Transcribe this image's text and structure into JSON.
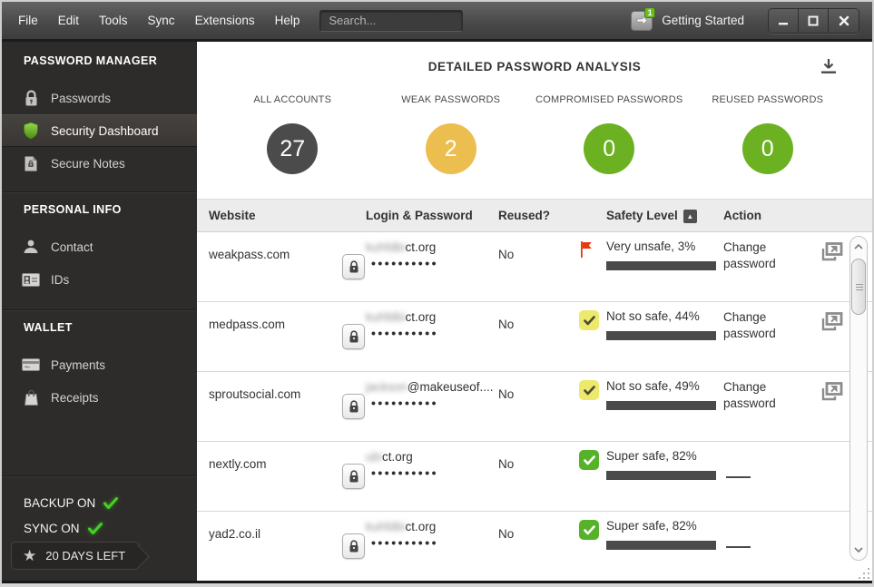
{
  "titlebar": {
    "menu": [
      "File",
      "Edit",
      "Tools",
      "Sync",
      "Extensions",
      "Help"
    ],
    "search_placeholder": "Search...",
    "getting_started_label": "Getting Started",
    "getting_started_badge": "1",
    "window_controls": [
      "minimize",
      "maximize",
      "close"
    ]
  },
  "sidebar": {
    "sections": [
      {
        "header": "PASSWORD MANAGER",
        "items": [
          {
            "label": "Passwords",
            "icon": "lock-icon",
            "selected": false
          },
          {
            "label": "Security Dashboard",
            "icon": "shield-icon",
            "selected": true
          },
          {
            "label": "Secure Notes",
            "icon": "secure-note-icon",
            "selected": false
          }
        ]
      },
      {
        "header": "PERSONAL INFO",
        "items": [
          {
            "label": "Contact",
            "icon": "person-icon",
            "selected": false
          },
          {
            "label": "IDs",
            "icon": "id-card-icon",
            "selected": false
          }
        ]
      },
      {
        "header": "WALLET",
        "items": [
          {
            "label": "Payments",
            "icon": "credit-card-icon",
            "selected": false
          },
          {
            "label": "Receipts",
            "icon": "shopping-bag-icon",
            "selected": false
          }
        ]
      }
    ],
    "status": [
      {
        "label": "BACKUP ON",
        "icon": "green-check-icon"
      },
      {
        "label": "SYNC ON",
        "icon": "green-check-icon"
      }
    ],
    "trial_badge": {
      "label": "20 DAYS LEFT",
      "icon": "star-icon",
      "star_glyph": "★"
    }
  },
  "main": {
    "title": "DETAILED PASSWORD ANALYSIS",
    "download_icon": "export-report-icon",
    "stats": [
      {
        "label": "ALL ACCOUNTS",
        "value": "27",
        "color": "#4b4b4b"
      },
      {
        "label": "WEAK PASSWORDS",
        "value": "2",
        "color": "#ecbd4f"
      },
      {
        "label": "COMPROMISED PASSWORDS",
        "value": "0",
        "color": "#6cb121"
      },
      {
        "label": "REUSED PASSWORDS",
        "value": "0",
        "color": "#6cb121"
      }
    ],
    "table": {
      "columns": [
        "Website",
        "Login & Password",
        "Reused?",
        "Safety Level",
        "Action"
      ],
      "sort_glyph": "▲",
      "rows": [
        {
          "website": "weakpass.com",
          "login_redacted": "kuhfdbi",
          "login_visible": "ct.org",
          "password_mask": "••••••••••",
          "reused": "No",
          "status_icon": "red-flag-icon",
          "safety_text": "Very unsafe, 3%",
          "safety_pct": 3,
          "bar_color": "#e8380d",
          "action": "Change password"
        },
        {
          "website": "medpass.com",
          "login_redacted": "kuhfdbi",
          "login_visible": "ct.org",
          "password_mask": "••••••••••",
          "reused": "No",
          "status_icon": "yellow-check-icon",
          "safety_text": "Not so safe, 44%",
          "safety_pct": 44,
          "bar_color": "#e8e24c",
          "action": "Change password"
        },
        {
          "website": "sproutsocial.com",
          "login_redacted": "jackson",
          "login_visible": "@makeuseof....",
          "password_mask": "••••••••••",
          "reused": "No",
          "status_icon": "yellow-check-icon",
          "safety_text": "Not so safe, 49%",
          "safety_pct": 49,
          "bar_color": "#e8e24c",
          "action": "Change password"
        },
        {
          "website": "nextly.com",
          "login_redacted": "ubi",
          "login_visible": "ct.org",
          "password_mask": "••••••••••",
          "reused": "No",
          "status_icon": "green-check-icon",
          "safety_text": "Super safe, 82%",
          "safety_pct": 82,
          "bar_color": "#76b82a",
          "action": ""
        },
        {
          "website": "yad2.co.il",
          "login_redacted": "kuhfdbi",
          "login_visible": "ct.org",
          "password_mask": "••••••••••",
          "reused": "No",
          "status_icon": "green-check-icon",
          "safety_text": "Super safe, 82%",
          "safety_pct": 82,
          "bar_color": "#76b82a",
          "action": ""
        }
      ]
    }
  }
}
